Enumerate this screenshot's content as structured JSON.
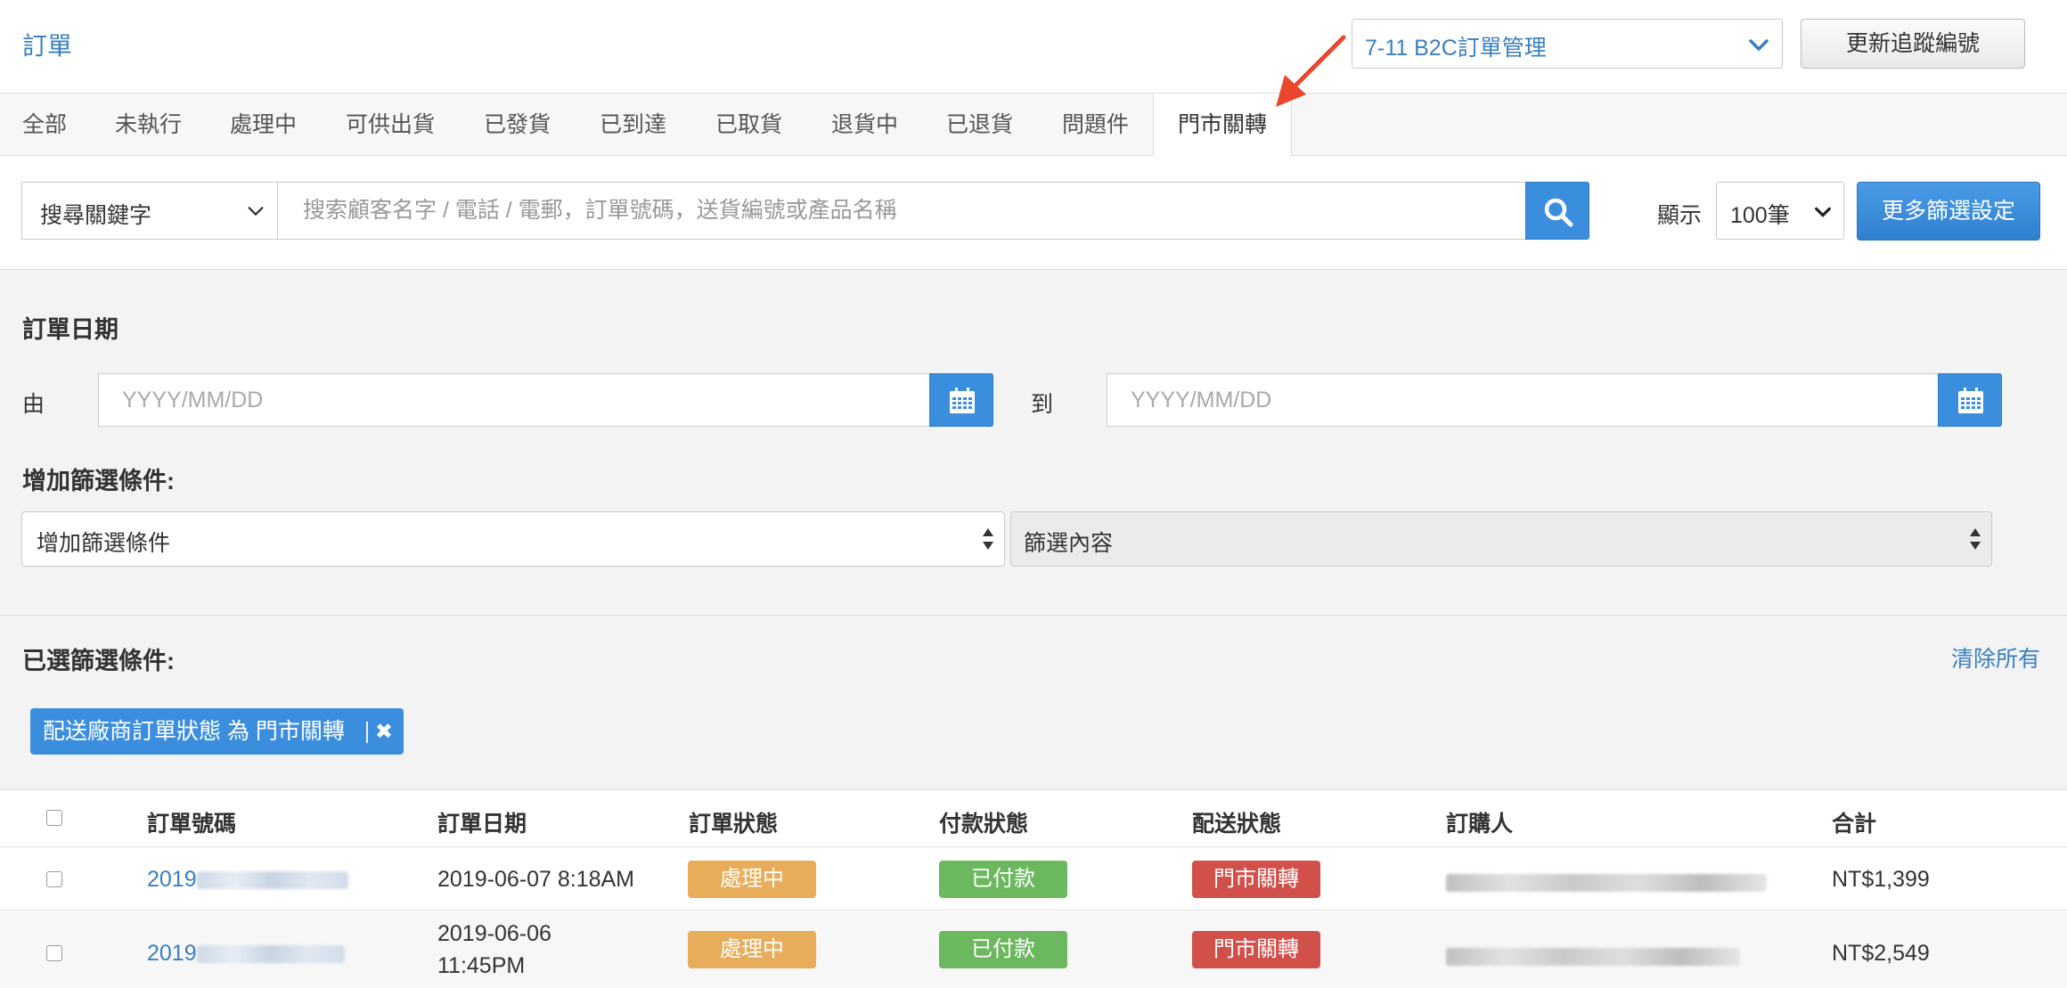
{
  "header": {
    "title": "訂單",
    "store_select": "7-11 B2C訂單管理",
    "update_button": "更新追蹤編號"
  },
  "tabs": [
    {
      "label": "全部"
    },
    {
      "label": "未執行"
    },
    {
      "label": "處理中"
    },
    {
      "label": "可供出貨"
    },
    {
      "label": "已發貨"
    },
    {
      "label": "已到達"
    },
    {
      "label": "已取貨"
    },
    {
      "label": "退貨中"
    },
    {
      "label": "已退貨"
    },
    {
      "label": "問題件"
    },
    {
      "label": "門市關轉",
      "active": true
    }
  ],
  "search": {
    "keyword_select": "搜尋關鍵字",
    "placeholder": "搜索顧客名字 / 電話 / 電郵，訂單號碼，送貨編號或產品名稱",
    "show_label": "顯示",
    "count_select": "100筆",
    "more_filters_button": "更多篩選設定"
  },
  "filters": {
    "order_date_title": "訂單日期",
    "from_label": "由",
    "to_label": "到",
    "date_placeholder": "YYYY/MM/DD",
    "add_condition_title": "增加篩選條件:",
    "add_condition_select": "增加篩選條件",
    "filter_content_select": "篩選內容",
    "selected_title": "已選篩選條件:",
    "clear_all": "清除所有",
    "active_tag": "配送廠商訂單狀態 為 門市關轉"
  },
  "table": {
    "columns": [
      "訂單號碼",
      "訂單日期",
      "訂單狀態",
      "付款狀態",
      "配送狀態",
      "訂購人",
      "合計"
    ],
    "rows": [
      {
        "order_no": "2019",
        "date": "2019-06-07 8:18AM",
        "order_status": "處理中",
        "payment_status": "已付款",
        "delivery_status": "門市關轉",
        "total": "NT$1,399"
      },
      {
        "order_no": "2019",
        "date_line1": "2019-06-06",
        "date_line2": "11:45PM",
        "order_status": "處理中",
        "payment_status": "已付款",
        "delivery_status": "門市關轉",
        "total": "NT$2,549"
      }
    ]
  },
  "colors": {
    "accent": "#3b8ede",
    "link": "#3a7fc1",
    "processing": "#e8ad5a",
    "paid": "#6cb85f",
    "store_closed": "#d2504a",
    "annotation_arrow": "#e8472e"
  }
}
